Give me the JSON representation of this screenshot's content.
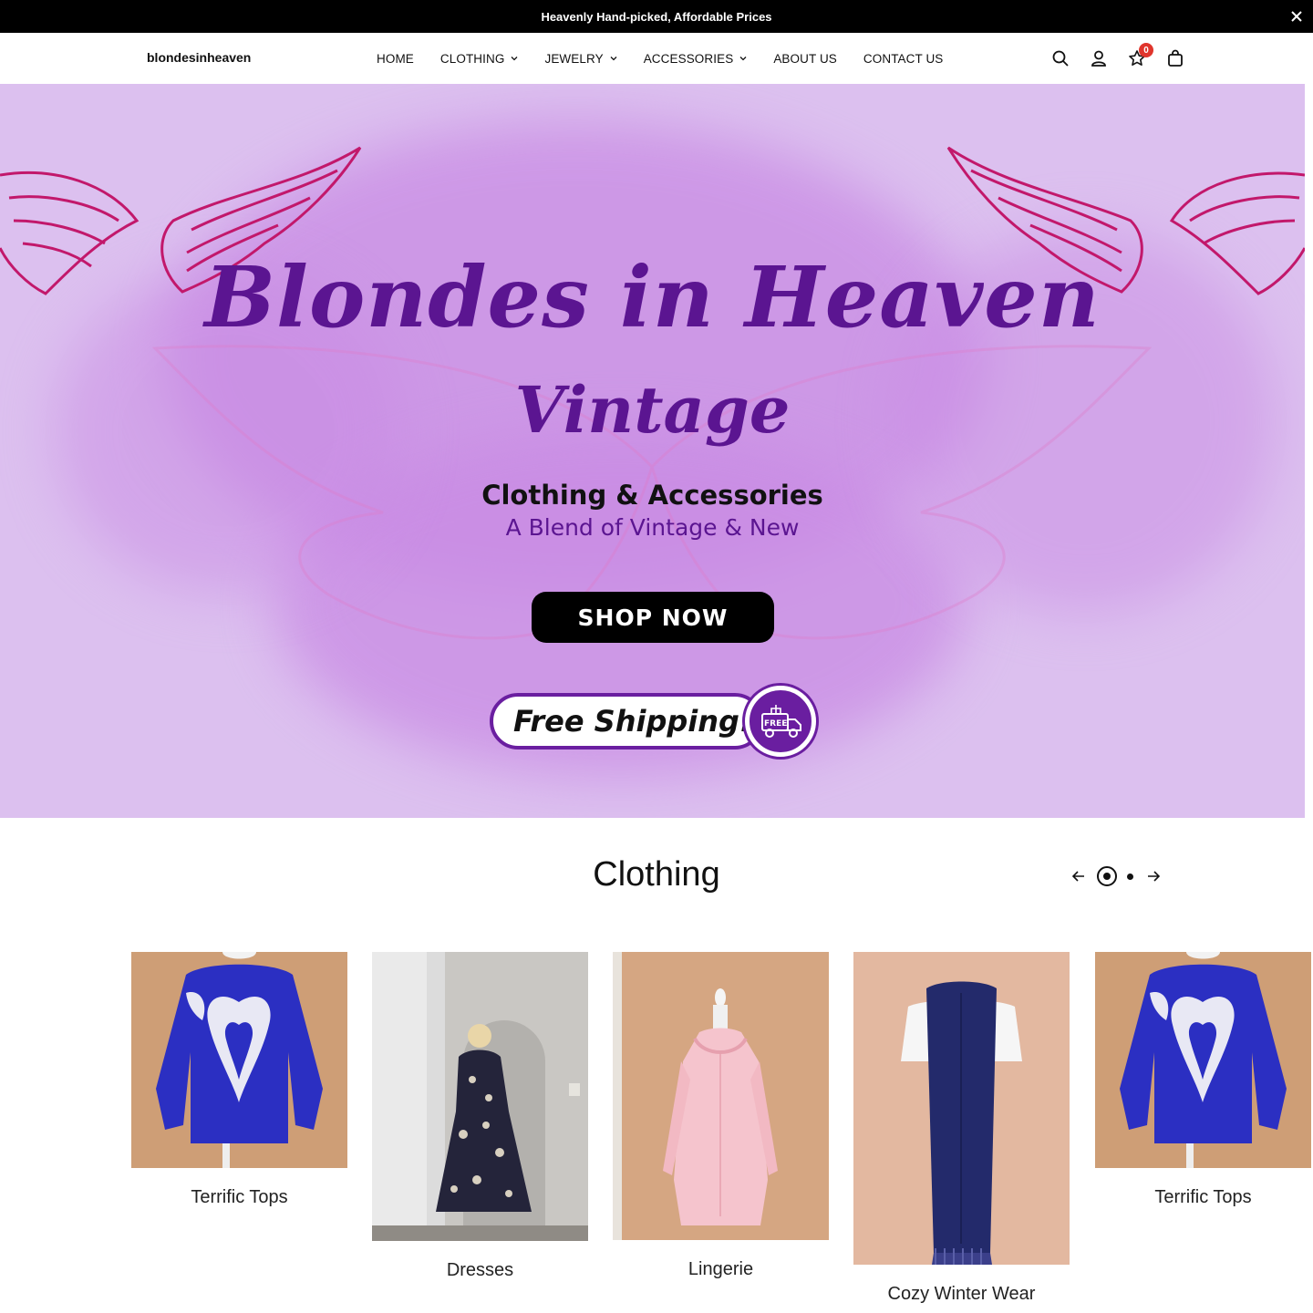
{
  "announcement": {
    "text": "Heavenly Hand-picked, Affordable Prices"
  },
  "header": {
    "logo": "blondesinheaven",
    "nav": [
      {
        "label": "HOME",
        "has_dropdown": false
      },
      {
        "label": "CLOTHING",
        "has_dropdown": true
      },
      {
        "label": "JEWELRY",
        "has_dropdown": true
      },
      {
        "label": "ACCESSORIES",
        "has_dropdown": true
      },
      {
        "label": "ABOUT US",
        "has_dropdown": false
      },
      {
        "label": "CONTACT US",
        "has_dropdown": false
      }
    ],
    "icons": [
      "search-icon",
      "account-icon",
      "wishlist-icon",
      "cart-icon"
    ],
    "wishlist_count": "0"
  },
  "hero": {
    "title": "Blondes in Heaven",
    "subtitle": "Vintage",
    "line1": "Clothing & Accessories",
    "line2": "A Blend of Vintage & New",
    "cta": "SHOP NOW",
    "shipping": "Free Shipping!",
    "shipping_badge": "FREE",
    "colors": {
      "background": "#dcc0ef",
      "splash": "#c98be4",
      "wings": "#c2186b",
      "text": "#5b1591"
    }
  },
  "section": {
    "title": "Clothing",
    "pager_pages": 2,
    "pager_active": 1
  },
  "cards": [
    {
      "label": "Terrific Tops"
    },
    {
      "label": "Dresses"
    },
    {
      "label": "Lingerie"
    },
    {
      "label": "Cozy Winter Wear"
    },
    {
      "label": "Terrific Tops"
    }
  ]
}
